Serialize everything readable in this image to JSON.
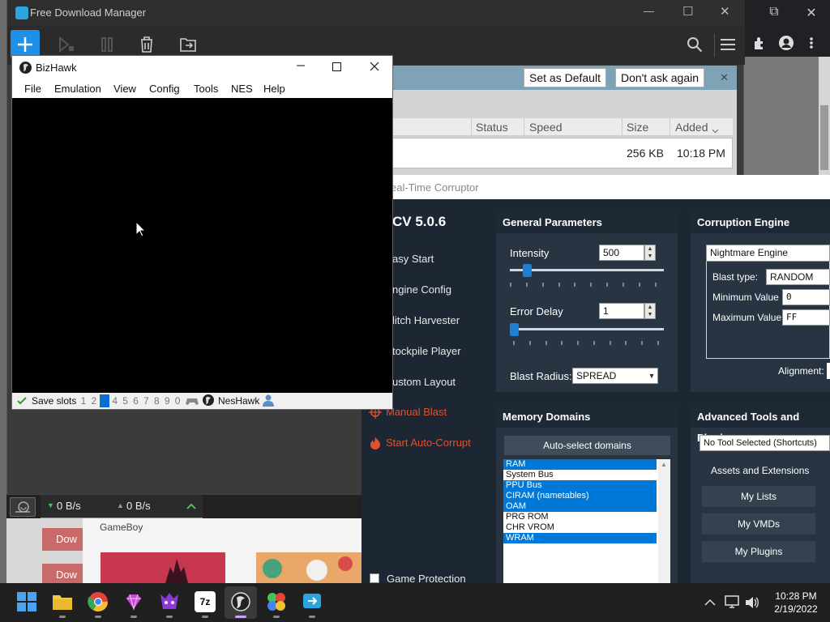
{
  "browser": {
    "restore": "⧉",
    "close": "✕"
  },
  "fdm": {
    "title": "Free Download Manager",
    "window_controls": {
      "minimize": "—",
      "maximize": "☐",
      "close": "✕"
    },
    "infobar": {
      "set_default": "Set as Default",
      "dont_ask": "Don't ask again",
      "close": "✕"
    },
    "columns": [
      "Status",
      "Speed",
      "Size",
      "Added"
    ],
    "row": {
      "size": "256 KB",
      "added": "10:18 PM"
    },
    "speed_down": "0 B/s",
    "speed_up": "0 B/s",
    "lower_section": "GameBoy",
    "lower_left_btn": "Dow"
  },
  "bizhawk": {
    "title": "BizHawk",
    "menu": [
      "File",
      "Emulation",
      "View",
      "Config",
      "Tools",
      "NES",
      "Help"
    ],
    "status": {
      "save_slots": "Save slots",
      "slots": [
        "1",
        "2",
        "3",
        "4",
        "5",
        "6",
        "7",
        "8",
        "9",
        "0"
      ],
      "core": "NesHawk"
    }
  },
  "rtc": {
    "title": "eal-Time Corruptor",
    "version": "CV 5.0.6",
    "nav": [
      "asy Start",
      "ngine Config",
      "litch Harvester",
      "tockpile Player",
      "ustom Layout"
    ],
    "manual_blast": "Manual Blast",
    "auto_corrupt": "Start Auto-Corrupt",
    "game_protection": "Game Protection",
    "general": {
      "title": "General Parameters",
      "intensity_label": "Intensity",
      "intensity_value": "500",
      "error_delay_label": "Error Delay",
      "error_delay_value": "1",
      "blast_radius_label": "Blast Radius:",
      "blast_radius_value": "SPREAD"
    },
    "engine": {
      "title": "Corruption Engine",
      "engine_value": "Nightmare Engine",
      "blast_type_label": "Blast type:",
      "blast_type_value": "RANDOM",
      "min_label": "Minimum Value",
      "min_value": "0",
      "max_label": "Maximum Value",
      "max_value": "FF",
      "alignment_label": "Alignment:"
    },
    "memory": {
      "title": "Memory Domains",
      "auto_select": "Auto-select domains",
      "domains": [
        {
          "name": "RAM",
          "selected": true
        },
        {
          "name": "System Bus",
          "selected": false
        },
        {
          "name": "PPU Bus",
          "selected": true
        },
        {
          "name": "CIRAM (nametables)",
          "selected": true
        },
        {
          "name": "OAM",
          "selected": true
        },
        {
          "name": "PRG ROM",
          "selected": false
        },
        {
          "name": "CHR VROM",
          "selected": false
        },
        {
          "name": "WRAM",
          "selected": true
        }
      ]
    },
    "advanced": {
      "title": "Advanced Tools and Plugins",
      "tool_select": "No Tool Selected (Shortcuts)",
      "assets_label": "Assets and Extensions",
      "buttons": [
        "My Lists",
        "My VMDs",
        "My Plugins"
      ]
    }
  },
  "taskbar": {
    "time": "10:28 PM",
    "date": "2/19/2022",
    "apps": [
      {
        "name": "start",
        "color": "#4aa3f0"
      },
      {
        "name": "file-explorer",
        "color": "#f2c94c"
      },
      {
        "name": "chrome",
        "color": "#e5443a"
      },
      {
        "name": "gem-app",
        "color": "#c74bd8"
      },
      {
        "name": "game-app",
        "color": "#8a3ad6"
      },
      {
        "name": "7zip",
        "color": "#ffffff"
      },
      {
        "name": "bizhawk",
        "color": "#dcdcdc"
      },
      {
        "name": "multicolor-app",
        "color": "#45c35c"
      },
      {
        "name": "fdm",
        "color": "#2aa5e0"
      }
    ],
    "sevenzip_label": "7z"
  }
}
